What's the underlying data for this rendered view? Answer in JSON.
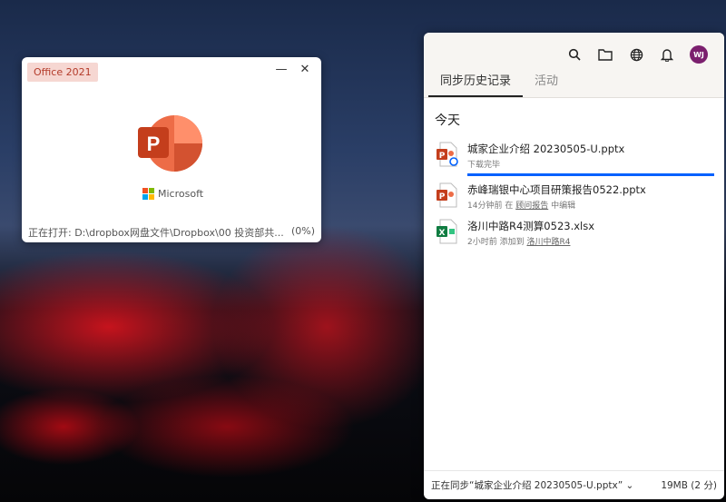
{
  "splash": {
    "badge": "Office 2021",
    "minimize": "—",
    "close": "✕",
    "brand": "Microsoft",
    "opening": "正在打开: D:\\dropbox网盘文件\\Dropbox\\00 投资部共...",
    "percent": "(0%)",
    "colors": {
      "powerpoint": "#c43e1c",
      "accent": "#ed6c47"
    }
  },
  "dropbox": {
    "header": {
      "icons": [
        "search-icon",
        "folder-icon",
        "globe-icon",
        "bell-icon"
      ],
      "avatar": "WJ"
    },
    "tabs": [
      {
        "label": "同步历史记录",
        "active": true
      },
      {
        "label": "活动",
        "active": false
      }
    ],
    "section": "今天",
    "files": [
      {
        "name": "城家企业介绍 20230505-U.pptx",
        "type": "pptx",
        "status": "下载完毕",
        "progress": 100
      },
      {
        "name": "赤峰瑞银中心项目研策报告0522.pptx",
        "type": "pptx",
        "time": "14分钟前 在",
        "folder": "顾问报告",
        "action": "中编辑"
      },
      {
        "name": "洛川中路R4测算0523.xlsx",
        "type": "xlsx",
        "time": "2小时前 添加到",
        "folder": "洛川中路R4"
      }
    ],
    "footer": {
      "syncing": "正在同步“城家企业介绍 20230505-U.pptx”",
      "size": "19MB (2 分)"
    },
    "colors": {
      "progress": "#0061fe",
      "avatar": "#7b1f6e"
    }
  }
}
